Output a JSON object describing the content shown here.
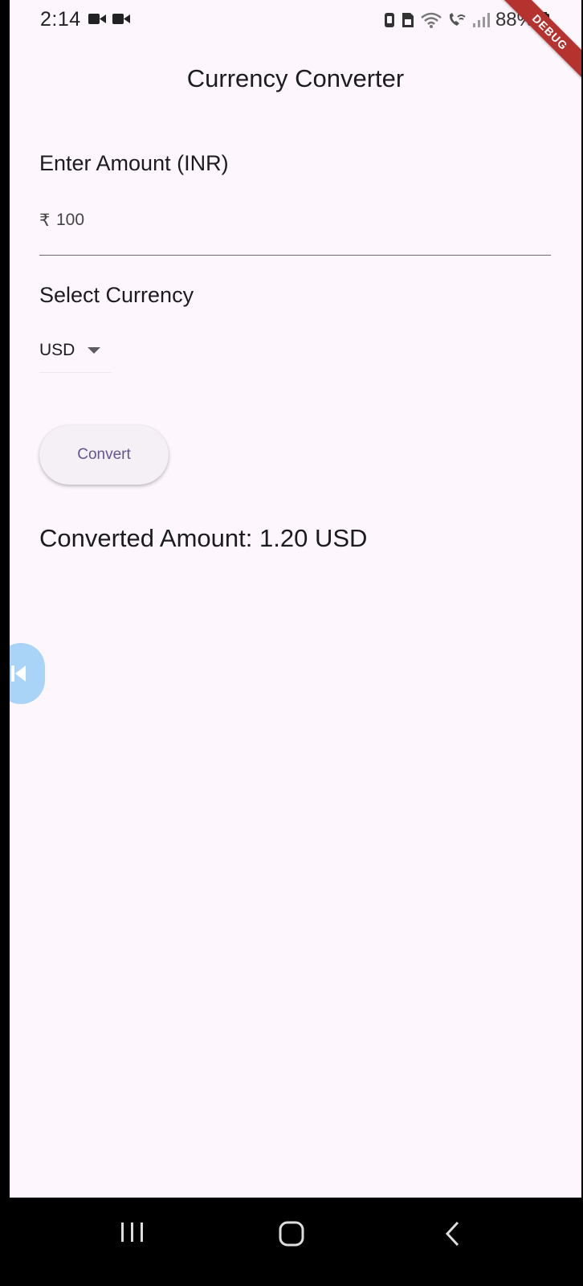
{
  "status_bar": {
    "time": "2:14",
    "battery": "88%",
    "icons": [
      "video-camera-icon",
      "video-camera-icon",
      "sim-icon",
      "storage-icon",
      "wifi-icon",
      "wifi-call-icon",
      "signal-icon",
      "battery-icon"
    ]
  },
  "debug_banner": "DEBUG",
  "app": {
    "title": "Currency Converter",
    "amount_label": "Enter Amount (INR)",
    "amount_prefix": "₹",
    "amount_value": "100",
    "currency_label": "Select Currency",
    "selected_currency": "USD",
    "convert_button": "Convert",
    "result_text": "Converted Amount: 1.20 USD"
  },
  "colors": {
    "background": "#fdf7fd",
    "button_text": "#65558f",
    "debug_ribbon": "#b5322f",
    "side_bubble": "#a9d4f7"
  },
  "nav_bar": {
    "icons": [
      "recent-apps-icon",
      "home-icon",
      "back-icon"
    ]
  }
}
